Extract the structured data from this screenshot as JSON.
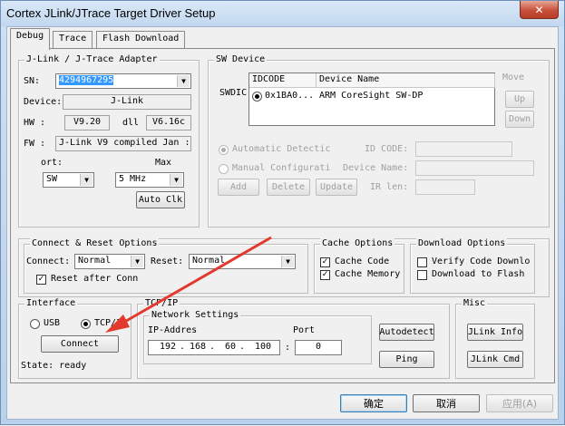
{
  "window": {
    "title": "Cortex JLink/JTrace Target Driver Setup",
    "close_label": "✕"
  },
  "tabs": [
    {
      "label": "Debug",
      "active": true
    },
    {
      "label": "Trace",
      "active": false
    },
    {
      "label": "Flash Download",
      "active": false
    }
  ],
  "jlink": {
    "title": "J-Link / J-Trace Adapter",
    "sn_label": "SN:",
    "sn_value": "4294967295",
    "device_label": "Device:",
    "device_value": "J-Link",
    "hw_label": "HW :",
    "hw_value": "V9.20",
    "dll_label": "dll",
    "dll_value": "V6.16c",
    "fw_label": "FW :",
    "fw_value": "J-Link V9 compiled Jan :",
    "port_label": "ort:",
    "port_value": "SW",
    "max_label": "Max",
    "max_value": "5 MHz",
    "auto_clk_label": "Auto Clk"
  },
  "sw_device": {
    "title": "SW Device",
    "row_label": "SWDIC",
    "col_idcode": "IDCODE",
    "col_device_name": "Device Name",
    "rows": [
      {
        "idcode": "0x1BA0...",
        "device_name": "ARM CoreSight SW-DP",
        "selected": true
      }
    ],
    "move_label": "Move",
    "up_label": "Up",
    "down_label": "Down",
    "auto_detect_label": "Automatic Detectic",
    "manual_config_label": "Manual Configurati",
    "id_code_label": "ID CODE:",
    "device_name_label": "Device Name:",
    "ir_len_label": "IR len:",
    "add_label": "Add",
    "delete_label": "Delete",
    "update_label": "Update"
  },
  "connect_reset": {
    "title": "Connect & Reset Options",
    "connect_label": "Connect:",
    "connect_value": "Normal",
    "reset_label": "Reset:",
    "reset_value": "Normal",
    "reset_after_connect_label": "Reset after Conn",
    "reset_after_connect_checked": true
  },
  "cache": {
    "title": "Cache Options",
    "cache_code_label": "Cache Code",
    "cache_code_checked": true,
    "cache_memory_label": "Cache Memory",
    "cache_memory_checked": true
  },
  "download": {
    "title": "Download Options",
    "verify_label": "Verify Code Downlo",
    "verify_checked": false,
    "download_flash_label": "Download to Flash",
    "download_flash_checked": false
  },
  "interface": {
    "title": "Interface",
    "usb_label": "USB",
    "tcpip_label": "TCP/IP",
    "selected": "TCP/IP",
    "connect_label": "Connect",
    "state_label": "State: ready"
  },
  "tcpip": {
    "title": "TCP/IP",
    "network_title": "Network Settings",
    "ip_label": "IP-Addres",
    "ip": [
      "192",
      "168",
      "60",
      "100"
    ],
    "port_label": "Port",
    "port_value": "0",
    "autodetect_label": "Autodetect",
    "ping_label": "Ping"
  },
  "misc": {
    "title": "Misc",
    "jlink_info_label": "JLink Info",
    "jlink_cmd_label": "JLink Cmd"
  },
  "footer": {
    "ok_label": "确定",
    "cancel_label": "取消",
    "apply_label": "应用(A)"
  },
  "colors": {
    "annotation_arrow": "#e23a2e",
    "selection": "#3399ff"
  }
}
